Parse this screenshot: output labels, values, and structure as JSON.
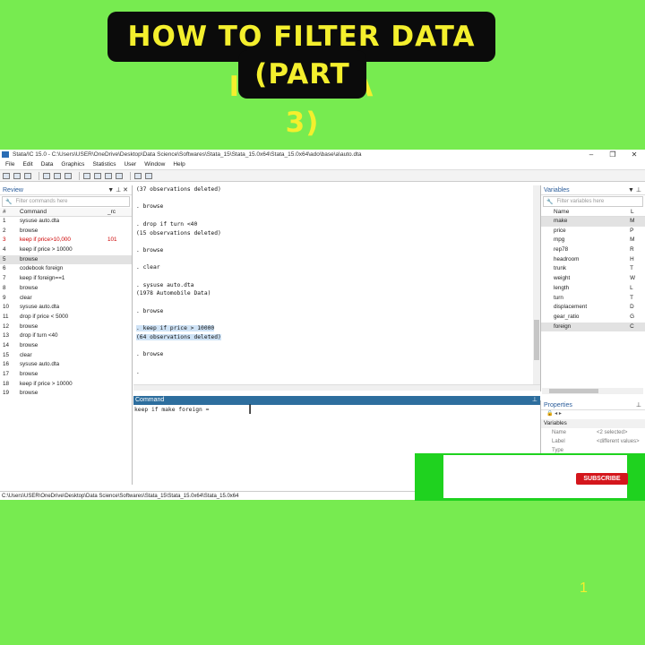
{
  "banner": {
    "line1": "HOW TO FILTER DATA IN STATA",
    "line2": "(PART 3)"
  },
  "window": {
    "title": "Stata/IC 15.0 - C:\\Users\\USER\\OneDrive\\Desktop\\Data Science\\Softwares\\Stata_15\\Stata_15.0x64\\Stata_15.0x64\\ado\\base\\a\\auto.dta"
  },
  "menu": [
    "File",
    "Edit",
    "Data",
    "Graphics",
    "Statistics",
    "User",
    "Window",
    "Help"
  ],
  "review": {
    "title": "Review",
    "filter_placeholder": "Filter commands here",
    "col_num": "#",
    "col_cmd": "Command",
    "col_rc": "_rc",
    "rows": [
      {
        "n": "1",
        "cmd": "sysuse auto.dta",
        "rc": ""
      },
      {
        "n": "2",
        "cmd": "browse",
        "rc": ""
      },
      {
        "n": "3",
        "cmd": "keep if price>10,000",
        "rc": "101"
      },
      {
        "n": "4",
        "cmd": "keep if price > 10000",
        "rc": ""
      },
      {
        "n": "5",
        "cmd": "browse",
        "rc": ""
      },
      {
        "n": "6",
        "cmd": "codebook foreign",
        "rc": ""
      },
      {
        "n": "7",
        "cmd": "keep if foreign==1",
        "rc": ""
      },
      {
        "n": "8",
        "cmd": "browse",
        "rc": ""
      },
      {
        "n": "9",
        "cmd": "clear",
        "rc": ""
      },
      {
        "n": "10",
        "cmd": "sysuse auto.dta",
        "rc": ""
      },
      {
        "n": "11",
        "cmd": "drop if price < 5000",
        "rc": ""
      },
      {
        "n": "12",
        "cmd": "browse",
        "rc": ""
      },
      {
        "n": "13",
        "cmd": "drop if turn <40",
        "rc": ""
      },
      {
        "n": "14",
        "cmd": "browse",
        "rc": ""
      },
      {
        "n": "15",
        "cmd": "clear",
        "rc": ""
      },
      {
        "n": "16",
        "cmd": "sysuse auto.dta",
        "rc": ""
      },
      {
        "n": "17",
        "cmd": "browse",
        "rc": ""
      },
      {
        "n": "18",
        "cmd": "keep if price > 10000",
        "rc": ""
      },
      {
        "n": "19",
        "cmd": "browse",
        "rc": ""
      }
    ]
  },
  "results": {
    "l1": "(37 observations deleted)",
    "l2": ". browse",
    "l3": ". drop if turn <40",
    "l4": "(15 observations deleted)",
    "l5": ". browse",
    "l6": ". clear",
    "l7": ". sysuse auto.dta",
    "l8": "(1978 Automobile Data)",
    "l9": ". browse",
    "l10": ". keep if price > 10000",
    "l11": "(64 observations deleted)",
    "l12": ". browse",
    "l13": "."
  },
  "command": {
    "title": "Command",
    "value": "keep if make foreign ="
  },
  "variables": {
    "title": "Variables",
    "filter_placeholder": "Filter variables here",
    "col_name": "Name",
    "col_label": "L",
    "rows": [
      {
        "name": "make",
        "label": "M"
      },
      {
        "name": "price",
        "label": "P"
      },
      {
        "name": "mpg",
        "label": "M"
      },
      {
        "name": "rep78",
        "label": "R"
      },
      {
        "name": "headroom",
        "label": "H"
      },
      {
        "name": "trunk",
        "label": "T"
      },
      {
        "name": "weight",
        "label": "W"
      },
      {
        "name": "length",
        "label": "L"
      },
      {
        "name": "turn",
        "label": "T"
      },
      {
        "name": "displacement",
        "label": "D"
      },
      {
        "name": "gear_ratio",
        "label": "G"
      },
      {
        "name": "foreign",
        "label": "C"
      }
    ]
  },
  "properties": {
    "title": "Properties",
    "section": "Variables",
    "name_key": "Name",
    "name_val": "<2 selected>",
    "label_key": "Label",
    "label_val": "<different values>",
    "type_key": "Type"
  },
  "statusbar": "C:\\Users\\USER\\OneDrive\\Desktop\\Data Science\\Softwares\\Stata_15\\Stata_15.0x64\\Stata_15.0x64",
  "subscribe": "SUBSCRIBE",
  "counter": "1"
}
